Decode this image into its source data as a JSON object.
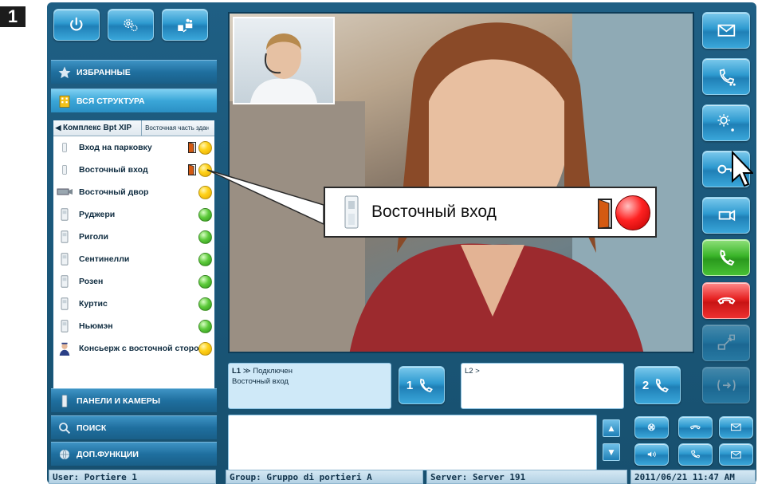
{
  "step_number": "1",
  "nav": {
    "favorites": "ИЗБРАННЫЕ",
    "structure": "ВСЯ СТРУКТУРА",
    "panels": "ПАНЕЛИ И КАМЕРЫ",
    "search": "ПОИСК",
    "extra": "ДОП.ФУНКЦИИ"
  },
  "breadcrumb": {
    "main": "Комплекс Bpt XIP",
    "sub": "Восточная часть здания"
  },
  "devices": [
    {
      "label": "Вход на парковку",
      "status": "yellow",
      "door": true
    },
    {
      "label": "Восточный вход",
      "status": "yellow",
      "door": true
    },
    {
      "label": "Восточный двор",
      "status": "yellow",
      "door": false
    },
    {
      "label": "Руджери",
      "status": "green",
      "door": false
    },
    {
      "label": "Риголи",
      "status": "green",
      "door": false
    },
    {
      "label": "Сентинелли",
      "status": "green",
      "door": false
    },
    {
      "label": "Розен",
      "status": "green",
      "door": false
    },
    {
      "label": "Куртис",
      "status": "green",
      "door": false
    },
    {
      "label": "Ньюмэн",
      "status": "green",
      "door": false
    },
    {
      "label": "Консьерж с восточной стороны",
      "status": "yellow",
      "door": false
    }
  ],
  "callout": {
    "label": "Восточный вход"
  },
  "line1": {
    "label": "L1",
    "status": "≫ Подключен",
    "name": "Восточный вход"
  },
  "line2": {
    "label": "L2 >"
  },
  "line_buttons": {
    "one": "1",
    "two": "2"
  },
  "status_bar": {
    "user": "User: Portiere 1",
    "group": "Group: Gruppo di portieri A",
    "server": "Server: Server 191",
    "datetime": "2011/06/21 11:47 AM"
  },
  "colors": {
    "frame": "#1f5f84",
    "accent": "#2e9ad0",
    "answer": "#3bb52a",
    "hangup": "#e62222"
  }
}
